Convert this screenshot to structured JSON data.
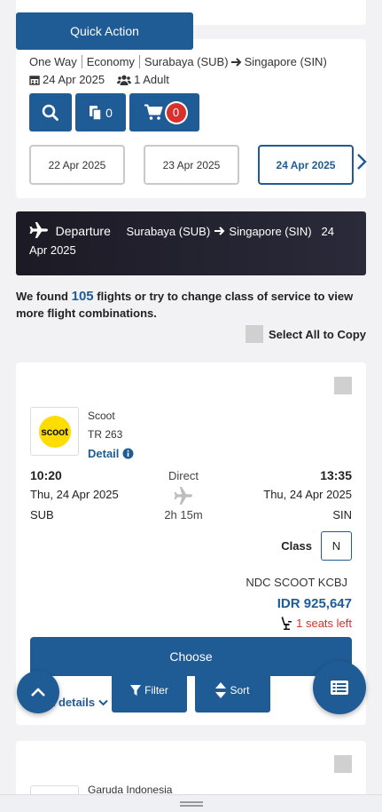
{
  "quick_action": "Quick Action",
  "search": {
    "trip_type": "One Way",
    "cabin": "Economy",
    "origin": "Surabaya (SUB)",
    "destination": "Singapore (SIN)",
    "date": "24 Apr 2025",
    "passengers": "1 Adult",
    "copy_count": "0",
    "cart_count": "0"
  },
  "dates": [
    {
      "label": "22 Apr 2025",
      "active": false
    },
    {
      "label": "23 Apr 2025",
      "active": false
    },
    {
      "label": "24 Apr 2025",
      "active": true
    }
  ],
  "departure": {
    "label": "Departure",
    "origin": "Surabaya (SUB)",
    "destination": "Singapore (SIN)",
    "date": "24 Apr 2025"
  },
  "results": {
    "prefix": "We found",
    "count": "105",
    "suffix": "flights or try to change class of service to view more flight combinations.",
    "select_all": "Select All to Copy"
  },
  "flight": {
    "airline": "Scoot",
    "logo_text": "scoot",
    "flight_no": "TR 263",
    "detail": "Detail",
    "dep_time": "10:20",
    "dep_date": "Thu, 24 Apr 2025",
    "dep_code": "SUB",
    "stops": "Direct",
    "duration": "2h 15m",
    "arr_time": "13:35",
    "arr_date": "Thu, 24 Apr 2025",
    "arr_code": "SIN",
    "class_label": "Class",
    "class_value": "N",
    "fare_basis": "NDC SCOOT KCBJ",
    "price": "IDR 925,647",
    "seats": "1 seats left",
    "choose": "Choose",
    "details_link": "t details"
  },
  "flight2": {
    "airline": "Garuda Indonesia"
  },
  "toolbar": {
    "filter": "Filter",
    "sort": "Sort"
  },
  "colors": {
    "primary": "#1f5b95",
    "danger": "#d9302c",
    "scoot_yellow": "#ffdd00"
  }
}
